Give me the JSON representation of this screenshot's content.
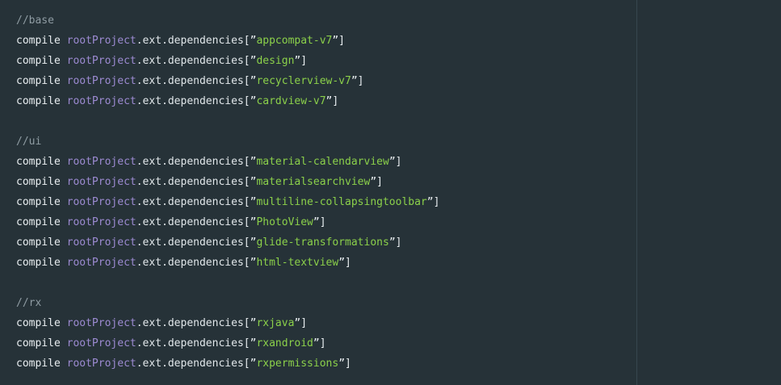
{
  "colors": {
    "background": "#263238",
    "comment": "#8f9ca3",
    "keyword": "#e8edf0",
    "object": "#9c8ad1",
    "string": "#8bd04a"
  },
  "code": {
    "keyword": "compile",
    "object": "rootProject",
    "accessor": ".ext.dependencies",
    "sections": [
      {
        "comment": "//base",
        "items": [
          "appcompat-v7",
          "design",
          "recyclerview-v7",
          "cardview-v7"
        ]
      },
      {
        "comment": "//ui",
        "items": [
          "material-calendarview",
          "materialsearchview",
          "multiline-collapsingtoolbar",
          "PhotoView",
          "glide-transformations",
          "html-textview"
        ]
      },
      {
        "comment": "//rx",
        "items": [
          "rxjava",
          "rxandroid",
          "rxpermissions"
        ]
      }
    ]
  }
}
